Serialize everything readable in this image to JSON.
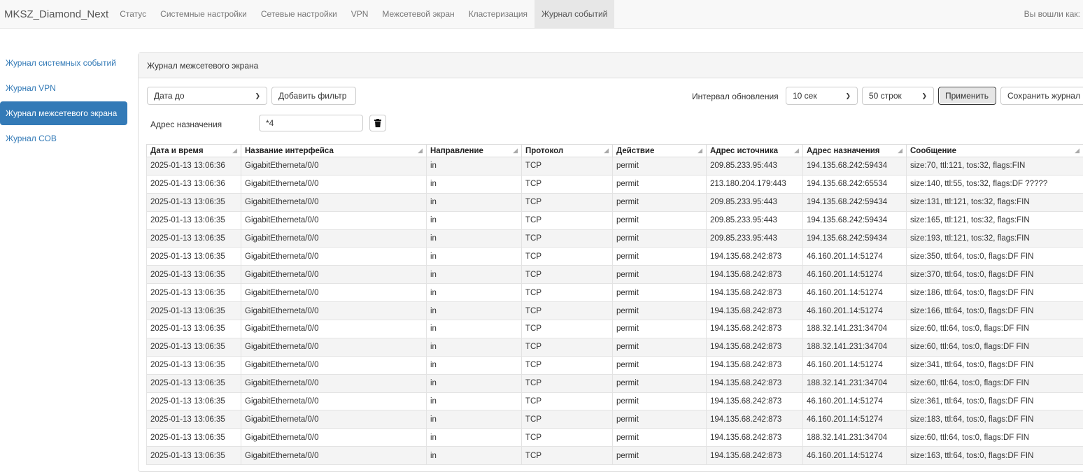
{
  "navbar": {
    "brand": "MKSZ_Diamond_Next",
    "items": [
      "Статус",
      "Системные настройки",
      "Сетевые настройки",
      "VPN",
      "Межсетевой экран",
      "Кластеризация",
      "Журнал событий"
    ],
    "active_index": 6,
    "logged_in": "Вы вошли как:"
  },
  "sidebar": {
    "items": [
      "Журнал системных событий",
      "Журнал VPN",
      "Журнал межсетевого экрана",
      "Журнал СОВ"
    ],
    "active_index": 2
  },
  "panel": {
    "title": "Журнал межсетевого экрана",
    "filter_select": "Дата до",
    "add_filter_label": "Добавить фильтр",
    "interval_label": "Интервал обновления",
    "interval_value": "10 сек",
    "rows_value": "50 строк",
    "apply_label": "Применить",
    "save_label": "Сохранить журнал",
    "dest_filter_label": "Адрес назначения",
    "dest_filter_value": "*4"
  },
  "table": {
    "columns": [
      "Дата и время",
      "Название интерфейса",
      "Направление",
      "Протокол",
      "Действие",
      "Адрес источника",
      "Адрес назначения",
      "Сообщение"
    ],
    "rows": [
      [
        "2025-01-13 13:06:36",
        "GigabitEtherneta/0/0",
        "in",
        "TCP",
        "permit",
        "209.85.233.95:443",
        "194.135.68.242:59434",
        "size:70, ttl:121, tos:32, flags:FIN"
      ],
      [
        "2025-01-13 13:06:36",
        "GigabitEtherneta/0/0",
        "in",
        "TCP",
        "permit",
        "213.180.204.179:443",
        "194.135.68.242:65534",
        "size:140, ttl:55, tos:32, flags:DF ?????"
      ],
      [
        "2025-01-13 13:06:35",
        "GigabitEtherneta/0/0",
        "in",
        "TCP",
        "permit",
        "209.85.233.95:443",
        "194.135.68.242:59434",
        "size:131, ttl:121, tos:32, flags:FIN"
      ],
      [
        "2025-01-13 13:06:35",
        "GigabitEtherneta/0/0",
        "in",
        "TCP",
        "permit",
        "209.85.233.95:443",
        "194.135.68.242:59434",
        "size:165, ttl:121, tos:32, flags:FIN"
      ],
      [
        "2025-01-13 13:06:35",
        "GigabitEtherneta/0/0",
        "in",
        "TCP",
        "permit",
        "209.85.233.95:443",
        "194.135.68.242:59434",
        "size:193, ttl:121, tos:32, flags:FIN"
      ],
      [
        "2025-01-13 13:06:35",
        "GigabitEtherneta/0/0",
        "in",
        "TCP",
        "permit",
        "194.135.68.242:873",
        "46.160.201.14:51274",
        "size:350, ttl:64, tos:0, flags:DF FIN"
      ],
      [
        "2025-01-13 13:06:35",
        "GigabitEtherneta/0/0",
        "in",
        "TCP",
        "permit",
        "194.135.68.242:873",
        "46.160.201.14:51274",
        "size:370, ttl:64, tos:0, flags:DF FIN"
      ],
      [
        "2025-01-13 13:06:35",
        "GigabitEtherneta/0/0",
        "in",
        "TCP",
        "permit",
        "194.135.68.242:873",
        "46.160.201.14:51274",
        "size:186, ttl:64, tos:0, flags:DF FIN"
      ],
      [
        "2025-01-13 13:06:35",
        "GigabitEtherneta/0/0",
        "in",
        "TCP",
        "permit",
        "194.135.68.242:873",
        "46.160.201.14:51274",
        "size:166, ttl:64, tos:0, flags:DF FIN"
      ],
      [
        "2025-01-13 13:06:35",
        "GigabitEtherneta/0/0",
        "in",
        "TCP",
        "permit",
        "194.135.68.242:873",
        "188.32.141.231:34704",
        "size:60, ttl:64, tos:0, flags:DF FIN"
      ],
      [
        "2025-01-13 13:06:35",
        "GigabitEtherneta/0/0",
        "in",
        "TCP",
        "permit",
        "194.135.68.242:873",
        "188.32.141.231:34704",
        "size:60, ttl:64, tos:0, flags:DF FIN"
      ],
      [
        "2025-01-13 13:06:35",
        "GigabitEtherneta/0/0",
        "in",
        "TCP",
        "permit",
        "194.135.68.242:873",
        "46.160.201.14:51274",
        "size:341, ttl:64, tos:0, flags:DF FIN"
      ],
      [
        "2025-01-13 13:06:35",
        "GigabitEtherneta/0/0",
        "in",
        "TCP",
        "permit",
        "194.135.68.242:873",
        "188.32.141.231:34704",
        "size:60, ttl:64, tos:0, flags:DF FIN"
      ],
      [
        "2025-01-13 13:06:35",
        "GigabitEtherneta/0/0",
        "in",
        "TCP",
        "permit",
        "194.135.68.242:873",
        "46.160.201.14:51274",
        "size:361, ttl:64, tos:0, flags:DF FIN"
      ],
      [
        "2025-01-13 13:06:35",
        "GigabitEtherneta/0/0",
        "in",
        "TCP",
        "permit",
        "194.135.68.242:873",
        "46.160.201.14:51274",
        "size:183, ttl:64, tos:0, flags:DF FIN"
      ],
      [
        "2025-01-13 13:06:35",
        "GigabitEtherneta/0/0",
        "in",
        "TCP",
        "permit",
        "194.135.68.242:873",
        "188.32.141.231:34704",
        "size:60, ttl:64, tos:0, flags:DF FIN"
      ],
      [
        "2025-01-13 13:06:35",
        "GigabitEtherneta/0/0",
        "in",
        "TCP",
        "permit",
        "194.135.68.242:873",
        "46.160.201.14:51274",
        "size:163, ttl:64, tos:0, flags:DF FIN"
      ]
    ]
  }
}
